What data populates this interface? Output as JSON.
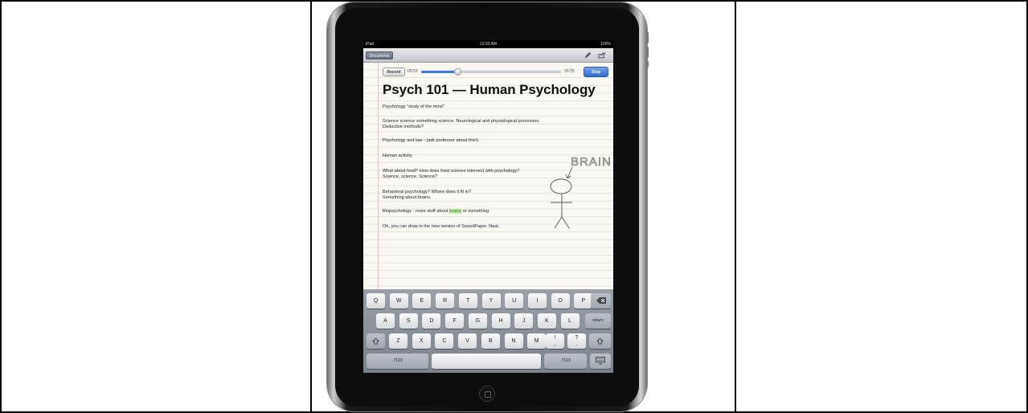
{
  "status_bar": {
    "carrier": "iPad",
    "time": "12:33 AM",
    "battery": "100%"
  },
  "toolbar": {
    "documents_label": "Documents",
    "pencil_icon": "pencil-icon",
    "share_icon": "share-icon"
  },
  "recorder": {
    "record_label": "Record",
    "elapsed": "00:53",
    "total": "03:25",
    "stop_label": "Stop",
    "progress": 0.26
  },
  "document": {
    "title": "Psych 101 — Human Psychology",
    "lines": [
      "Psychology \"study of the mind\"",
      "Science science something science. Neurological and physiological processes.",
      "Deductive methods?",
      "Psychology and law - (ask professor about this!)",
      "Human activity.",
      "What about food? How does food science intersect with psychology?",
      "Science, science. Science?",
      "Behavioral psychology? Where does it fit in?",
      "Something about brains."
    ],
    "bio_before": "Biopsychology - more stuff about ",
    "bio_highlight": "brains",
    "bio_after": " or something",
    "last_line": "Oh, you can draw in the new version of SoundPaper. Neat.",
    "drawing_label": "BRAIN"
  },
  "keyboard": {
    "row1": [
      "Q",
      "W",
      "E",
      "R",
      "T",
      "Y",
      "U",
      "I",
      "O",
      "P"
    ],
    "row2": [
      "A",
      "S",
      "D",
      "F",
      "G",
      "H",
      "J",
      "K",
      "L"
    ],
    "row3": [
      "Z",
      "X",
      "C",
      "V",
      "B",
      "N",
      "M"
    ],
    "row3_punct": [
      "!\n,",
      "?\n."
    ],
    "return_label": "return",
    "num_label": ".?123",
    "backspace_icon": "backspace-icon",
    "shift_icon": "shift-icon",
    "hide_icon": "keyboard-hide-icon"
  }
}
